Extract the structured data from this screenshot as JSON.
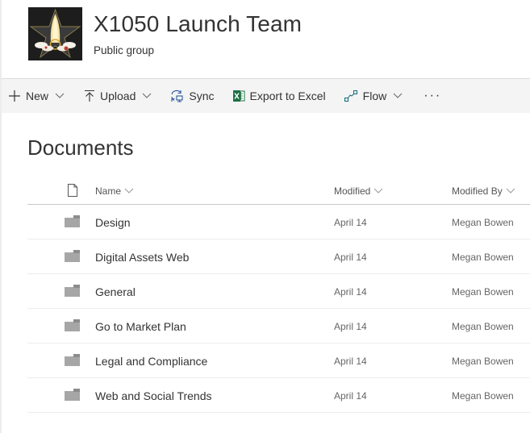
{
  "site": {
    "title": "X1050 Launch Team",
    "subtitle": "Public group",
    "logo_icon": "rocket-star-logo"
  },
  "commandbar": {
    "items": [
      {
        "label": "New",
        "icon": "plus-icon",
        "has_dropdown": true
      },
      {
        "label": "Upload",
        "icon": "upload-icon",
        "has_dropdown": true
      },
      {
        "label": "Sync",
        "icon": "sync-icon",
        "has_dropdown": false
      },
      {
        "label": "Export to Excel",
        "icon": "excel-icon",
        "has_dropdown": false
      },
      {
        "label": "Flow",
        "icon": "flow-icon",
        "has_dropdown": true
      }
    ],
    "more_label": "···"
  },
  "library": {
    "title": "Documents",
    "columns": {
      "name": "Name",
      "modified": "Modified",
      "modified_by": "Modified By"
    },
    "rows": [
      {
        "name": "Design",
        "type": "folder",
        "modified": "April 14",
        "modified_by": "Megan Bowen"
      },
      {
        "name": "Digital Assets Web",
        "type": "folder",
        "modified": "April 14",
        "modified_by": "Megan Bowen"
      },
      {
        "name": "General",
        "type": "folder",
        "modified": "April 14",
        "modified_by": "Megan Bowen"
      },
      {
        "name": "Go to Market Plan",
        "type": "folder",
        "modified": "April 14",
        "modified_by": "Megan Bowen"
      },
      {
        "name": "Legal and Compliance",
        "type": "folder",
        "modified": "April 14",
        "modified_by": "Megan Bowen"
      },
      {
        "name": "Web and Social Trends",
        "type": "folder",
        "modified": "April 14",
        "modified_by": "Megan Bowen"
      }
    ]
  },
  "colors": {
    "commandbar_bg": "#f4f4f4",
    "excel_green": "#1e7145",
    "flow_teal": "#0f6a7a",
    "folder_gray": "#a6a6a6"
  }
}
